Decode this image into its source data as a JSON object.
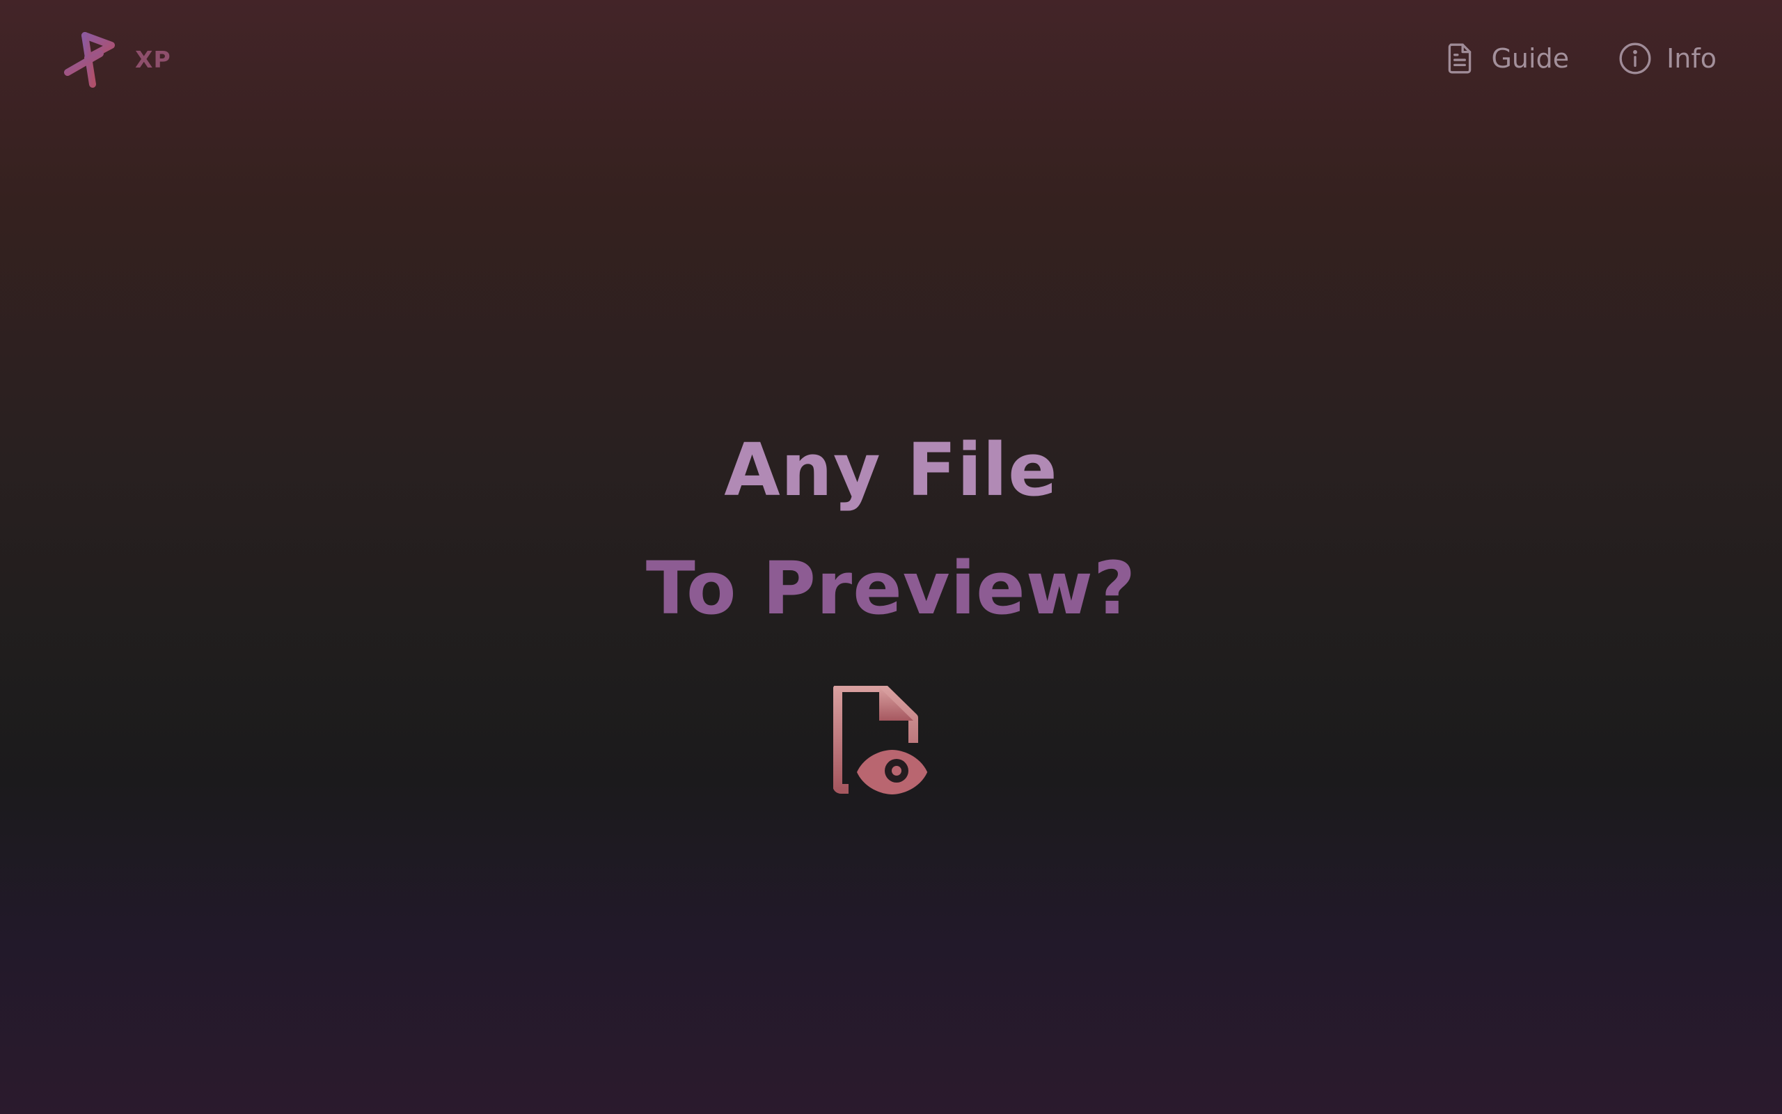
{
  "brand": {
    "name": "XP",
    "logo_icon": "xp-logo-icon"
  },
  "nav": {
    "items": [
      {
        "label": "Guide",
        "icon": "document-icon"
      },
      {
        "label": "Info",
        "icon": "info-icon"
      }
    ]
  },
  "hero": {
    "line1": "Any File",
    "line2": "To Preview?",
    "icon": "file-preview-icon"
  },
  "colors": {
    "accent_pink": "#c98a8f",
    "accent_purple": "#9b6aa5",
    "nav_text": "#a3909b",
    "brand_text": "#8e4f6c"
  }
}
